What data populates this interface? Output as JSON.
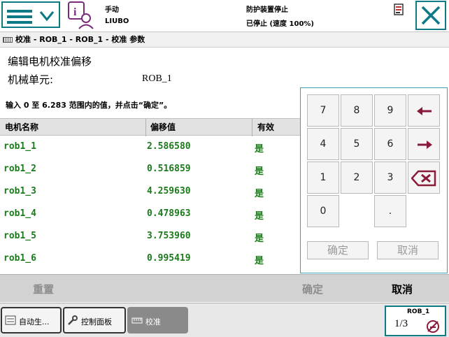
{
  "status": {
    "mode": "手动",
    "controller": "LIUBO",
    "state": "防护装置停止",
    "speed": "已停止 (速度 100%)"
  },
  "breadcrumb": "校准 - ROB_1 - ROB_1 - 校准 参数",
  "page": {
    "title": "编辑电机校准偏移",
    "unit_label": "机械单元:",
    "unit_value": "ROB_1",
    "instruction": "输入 0 至 6.283 范围内的值，并点击“确定”。"
  },
  "table": {
    "headers": [
      "电机名称",
      "偏移值",
      "有效"
    ],
    "rows": [
      {
        "name": "rob1_1",
        "offset": "2.586580",
        "valid": "是"
      },
      {
        "name": "rob1_2",
        "offset": "0.516859",
        "valid": "是"
      },
      {
        "name": "rob1_3",
        "offset": "4.259630",
        "valid": "是"
      },
      {
        "name": "rob1_4",
        "offset": "0.478963",
        "valid": "是"
      },
      {
        "name": "rob1_5",
        "offset": "3.753960",
        "valid": "是"
      },
      {
        "name": "rob1_6",
        "offset": "0.995419",
        "valid": "是"
      }
    ]
  },
  "keypad": {
    "keys": [
      "7",
      "8",
      "9",
      "4",
      "5",
      "6",
      "1",
      "2",
      "3",
      "0",
      "."
    ],
    "ok_label": "确定",
    "cancel_label": "取消"
  },
  "commands": {
    "reset": "重置",
    "ok": "确定",
    "cancel": "取消"
  },
  "taskbar": {
    "items": [
      "自动生...",
      "控制面板",
      "校准"
    ],
    "quickset_label": "ROB_1",
    "quickset_fraction": "1/3"
  },
  "colors": {
    "accent": "#0d7a86",
    "value_green": "#1a7a1a"
  }
}
